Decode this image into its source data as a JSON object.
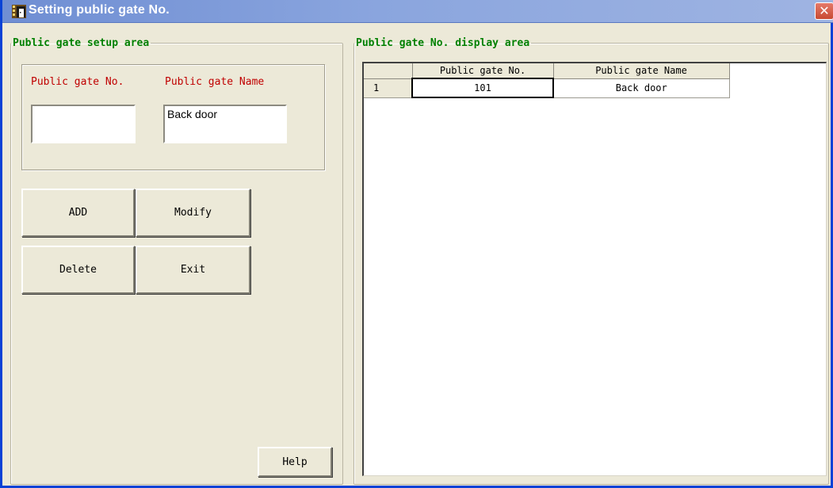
{
  "window": {
    "title": "Setting public gate No.",
    "close_glyph": "✕",
    "title_icon": "building-door-icon"
  },
  "setup_area": {
    "legend": "Public gate setup area",
    "gate_no_label": "Public gate No.",
    "gate_name_label": "Public gate Name",
    "gate_no_value": "",
    "gate_name_value": "Back door"
  },
  "buttons": {
    "add": "ADD",
    "modify": "Modify",
    "delete": "Delete",
    "exit": "Exit",
    "help": "Help"
  },
  "display_area": {
    "legend": "Public gate No. display area",
    "columns": [
      "",
      "Public gate No.",
      "Public gate Name"
    ],
    "rows": [
      {
        "index": "1",
        "gate_no": "101",
        "gate_name": "Back door"
      }
    ]
  },
  "colors": {
    "legend_text": "#008000",
    "field_label_text": "#c00000",
    "window_face": "#ece9d8",
    "titlebar": "#8aa5de"
  }
}
